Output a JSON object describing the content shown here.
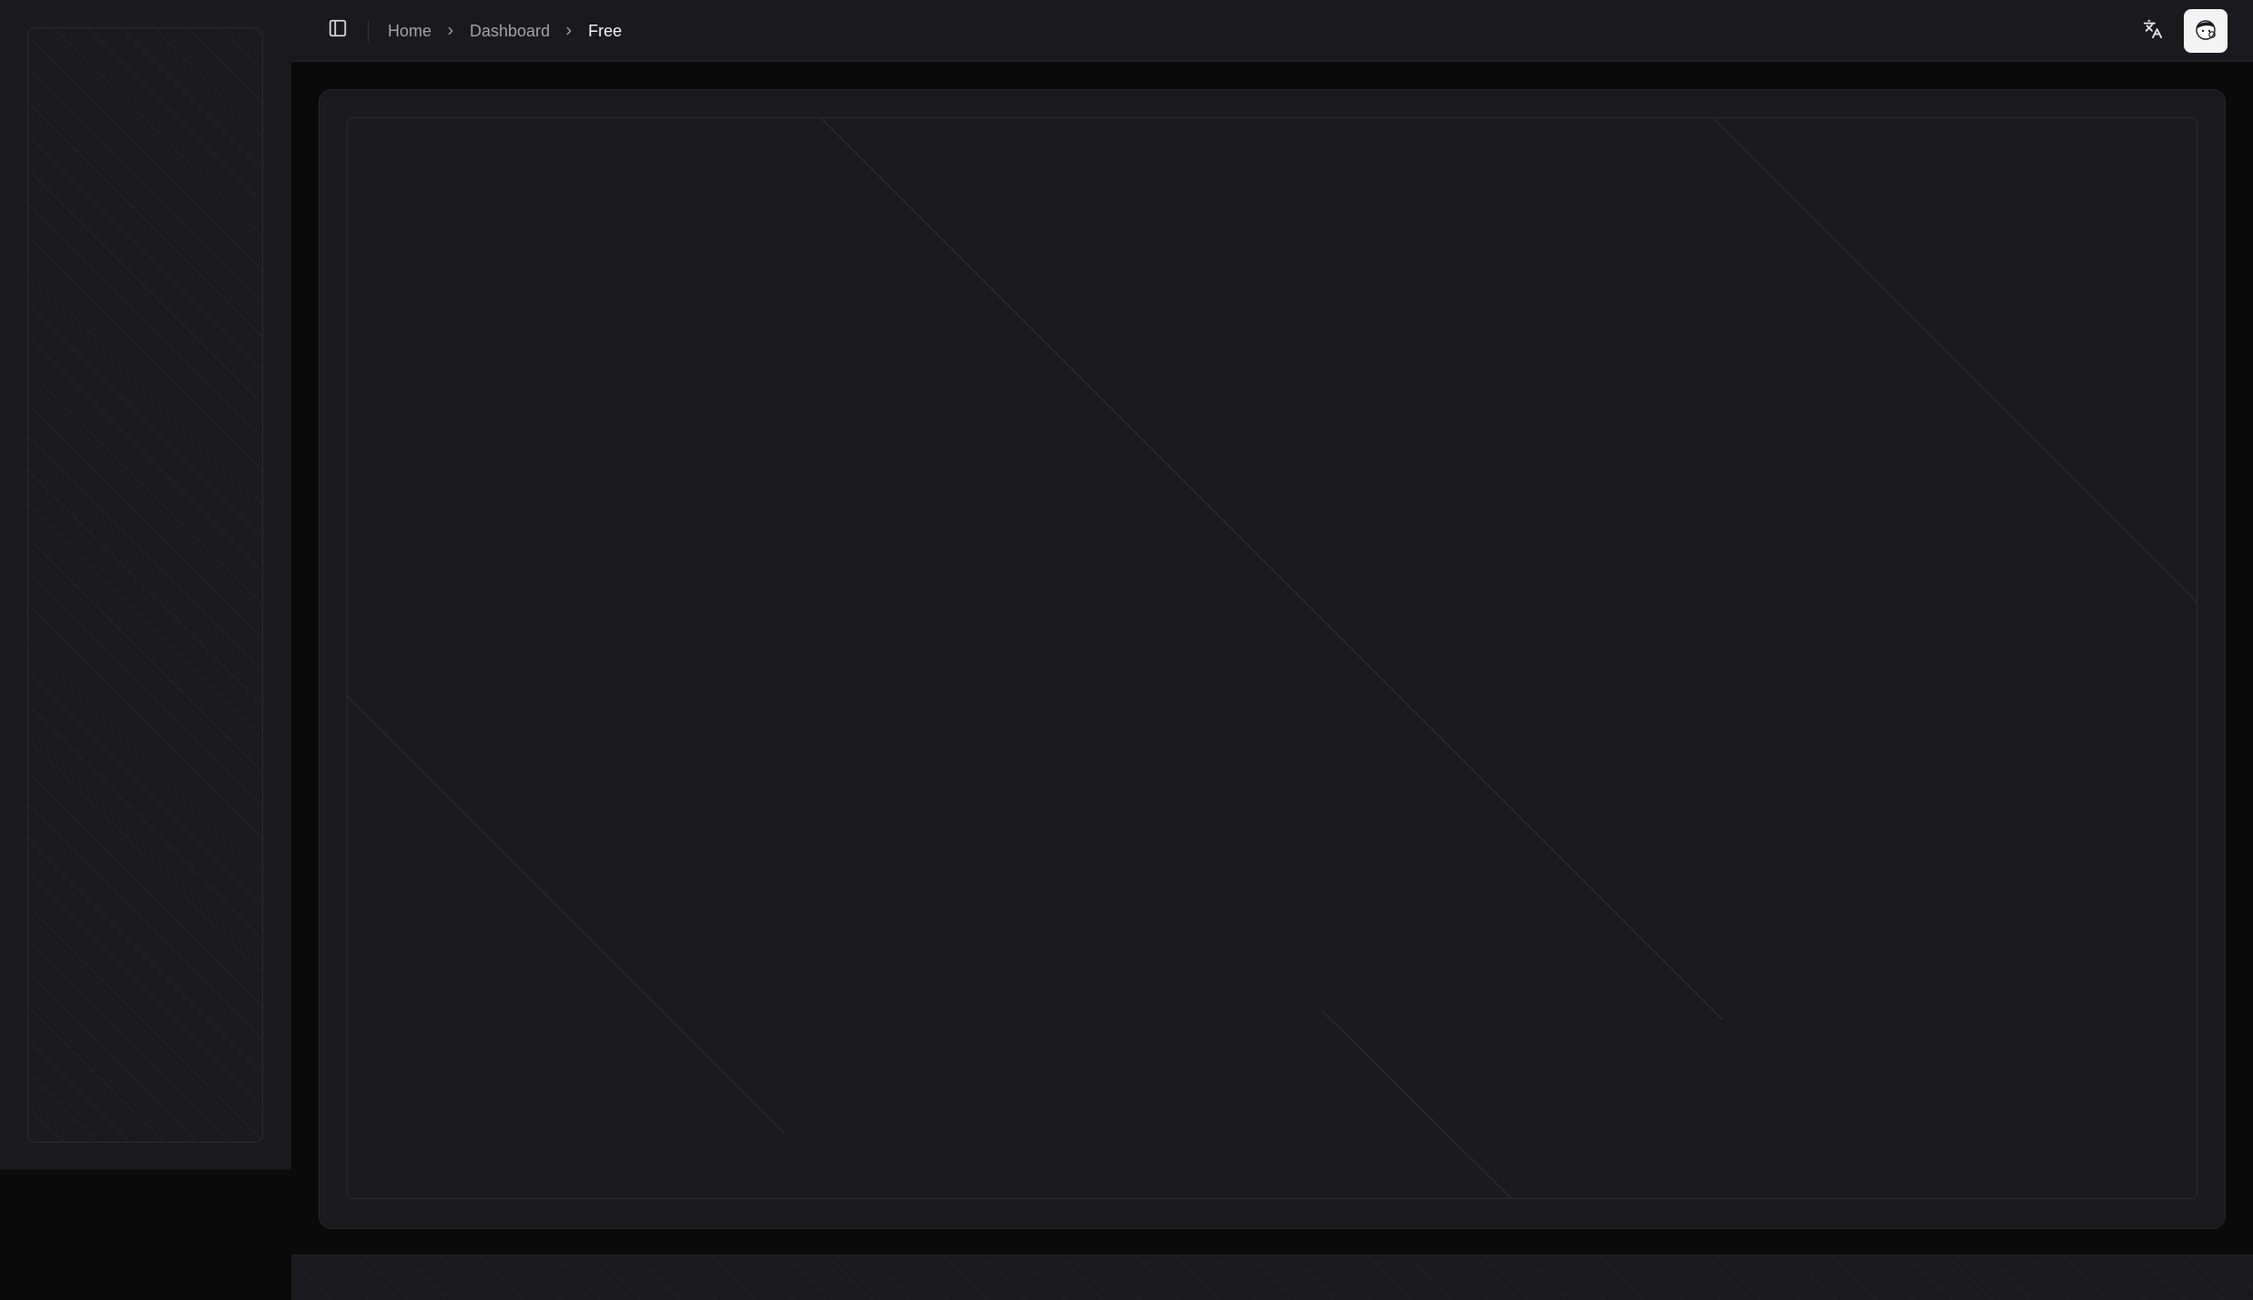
{
  "header": {
    "sidebar_toggle_icon": "panel-left-icon",
    "breadcrumb": {
      "home": "Home",
      "dashboard": "Dashboard",
      "current": "Free"
    },
    "translate_icon": "language-icon",
    "avatar_icon": "user-avatar"
  },
  "theme": {
    "background": "#0a0a0b",
    "surface": "#1a1a1e",
    "border": "#2a2a30",
    "text_muted": "#a1a1aa",
    "text_strong": "#f4f4f5"
  }
}
